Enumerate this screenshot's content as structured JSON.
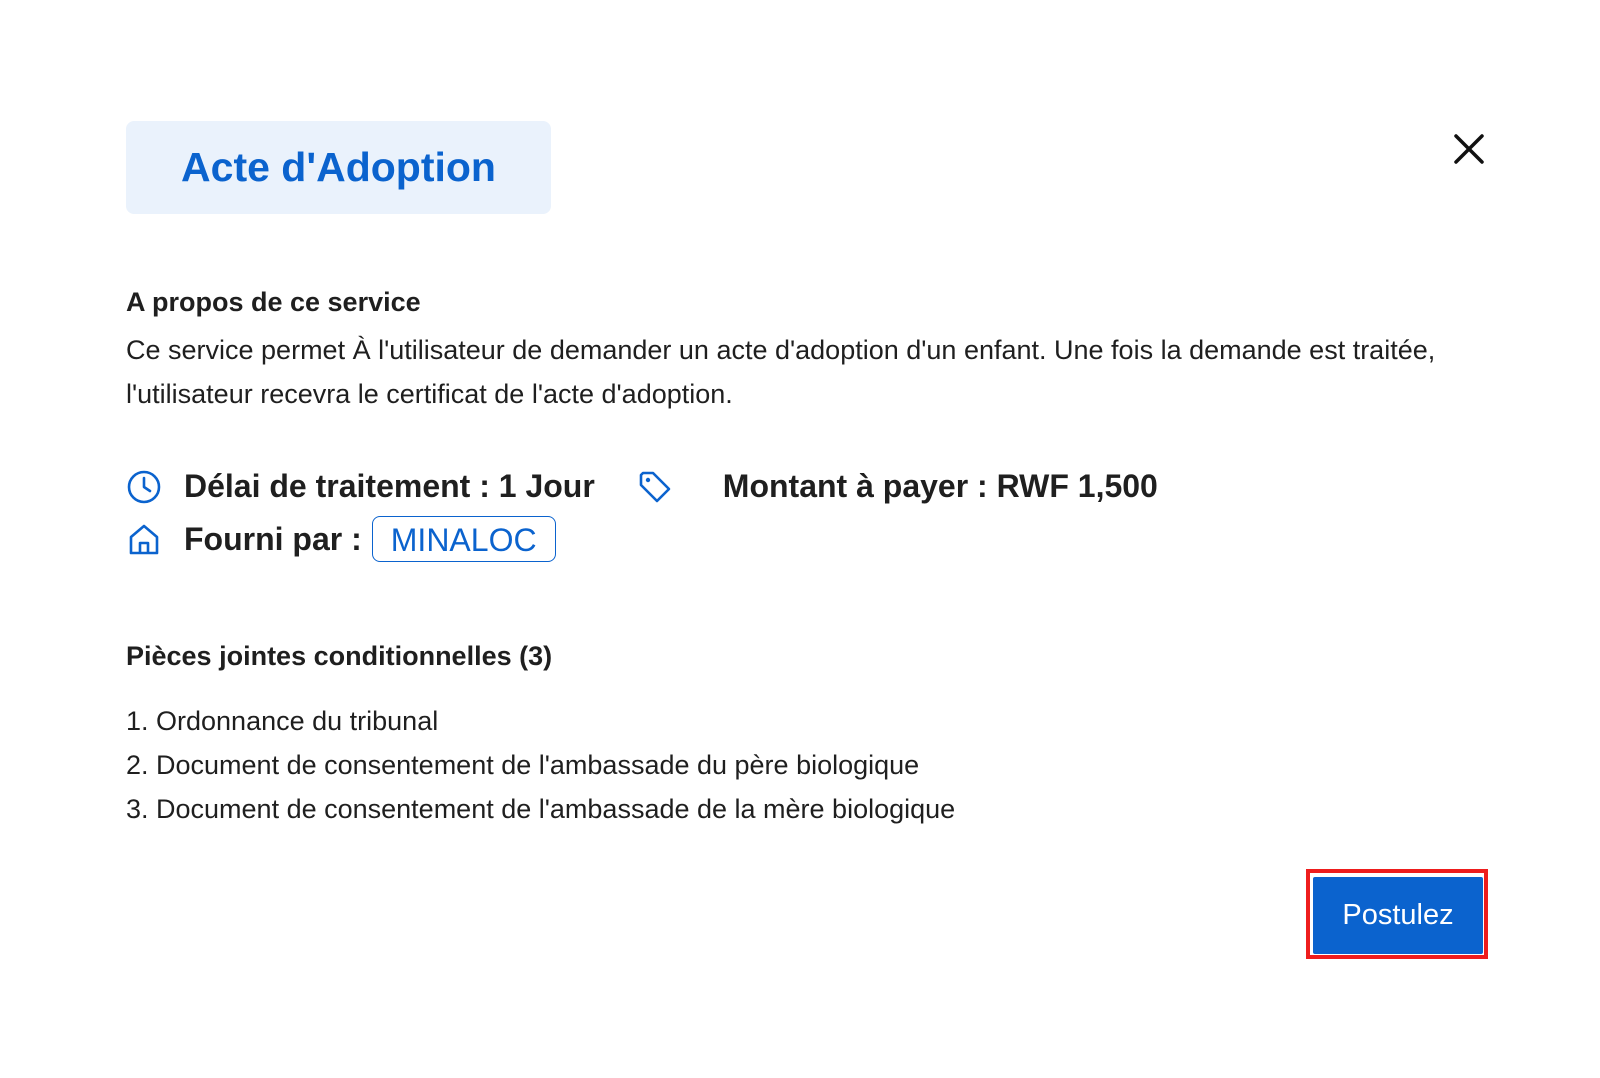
{
  "modal": {
    "title": "Acte d'Adoption",
    "close_icon": "close-icon"
  },
  "about": {
    "heading": "A propos de ce service",
    "text": "Ce service permet À l'utilisateur de demander un acte d'adoption d'un enfant. Une fois la demande est traitée, l'utilisateur recevra le certificat de l'acte d'adoption."
  },
  "meta": {
    "processing_icon": "clock-icon",
    "processing_label": "Délai de traitement : 1 Jour",
    "price_icon": "price-tag-icon",
    "price_label": "Montant à payer : RWF 1,500",
    "provider_icon": "home-icon",
    "provider_label": "Fourni par :",
    "provider_value": "MINALOC"
  },
  "attachments": {
    "heading": "Pièces jointes conditionnelles (3)",
    "items": [
      "1. Ordonnance du tribunal",
      "2. Document de consentement de l'ambassade du père biologique",
      "3. Document de consentement de l'ambassade de la mère biologique"
    ]
  },
  "actions": {
    "apply_label": "Postulez"
  },
  "colors": {
    "accent": "#0b63ce",
    "title_bg": "#eaf2fc",
    "highlight_outline": "#ee1d1d"
  }
}
